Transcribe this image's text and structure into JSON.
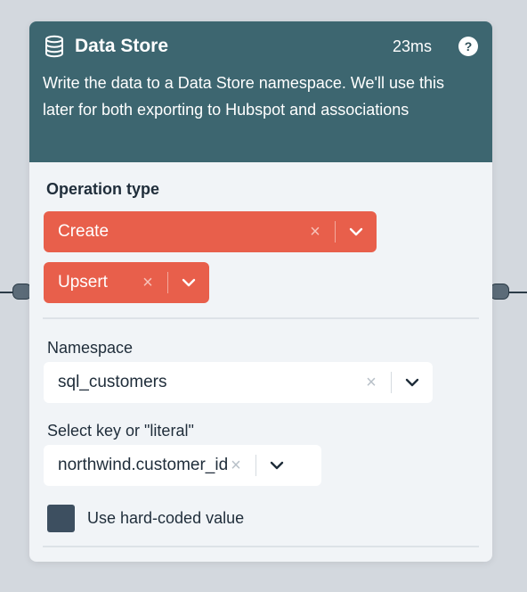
{
  "node": {
    "title": "Data Store",
    "timing": "23ms",
    "help_glyph": "?",
    "description": "Write the data to a Data Store namespace. We'll use this later for both exporting to Hubspot and associations",
    "icon": "database-icon"
  },
  "operation": {
    "label": "Operation type",
    "chips": [
      {
        "label": "Create",
        "clear": "×"
      },
      {
        "label": "Upsert",
        "clear": "×"
      }
    ]
  },
  "namespace": {
    "label": "Namespace",
    "value": "sql_customers",
    "clear": "×"
  },
  "key": {
    "label": "Select key or \"literal\"",
    "value": "northwind.customer_id",
    "clear": "×"
  },
  "hardcoded": {
    "label": "Use hard-coded value",
    "checked": false
  },
  "colors": {
    "header": "#3d6670",
    "chip": "#e85f4b",
    "canvas": "#d3d8de",
    "checkbox": "#3d4f60"
  }
}
